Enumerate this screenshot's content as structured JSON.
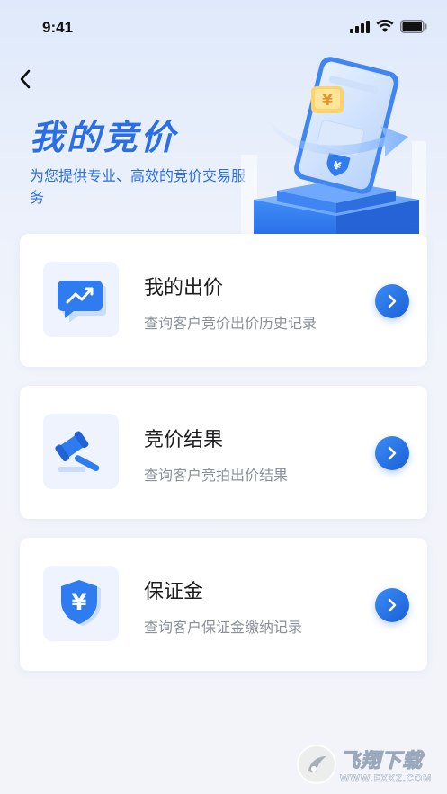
{
  "status_bar": {
    "time": "9:41"
  },
  "header": {
    "title": "我的竞价",
    "subtitle": "为您提供专业、高效的竞价交易服务"
  },
  "cards": [
    {
      "title": "我的出价",
      "desc": "查询客户竞价出价历史记录",
      "icon": "chart-bubble-icon"
    },
    {
      "title": "竞价结果",
      "desc": "查询客户竞拍出价结果",
      "icon": "gavel-icon"
    },
    {
      "title": "保证金",
      "desc": "查询客户保证金缴纳记录",
      "icon": "yuan-shield-icon"
    }
  ],
  "watermark": {
    "text": "飞翔下载",
    "url": "WWW.FXXZ.COM"
  },
  "colors": {
    "accent": "#2a6fe8",
    "arrow": "#1a5fd6"
  }
}
